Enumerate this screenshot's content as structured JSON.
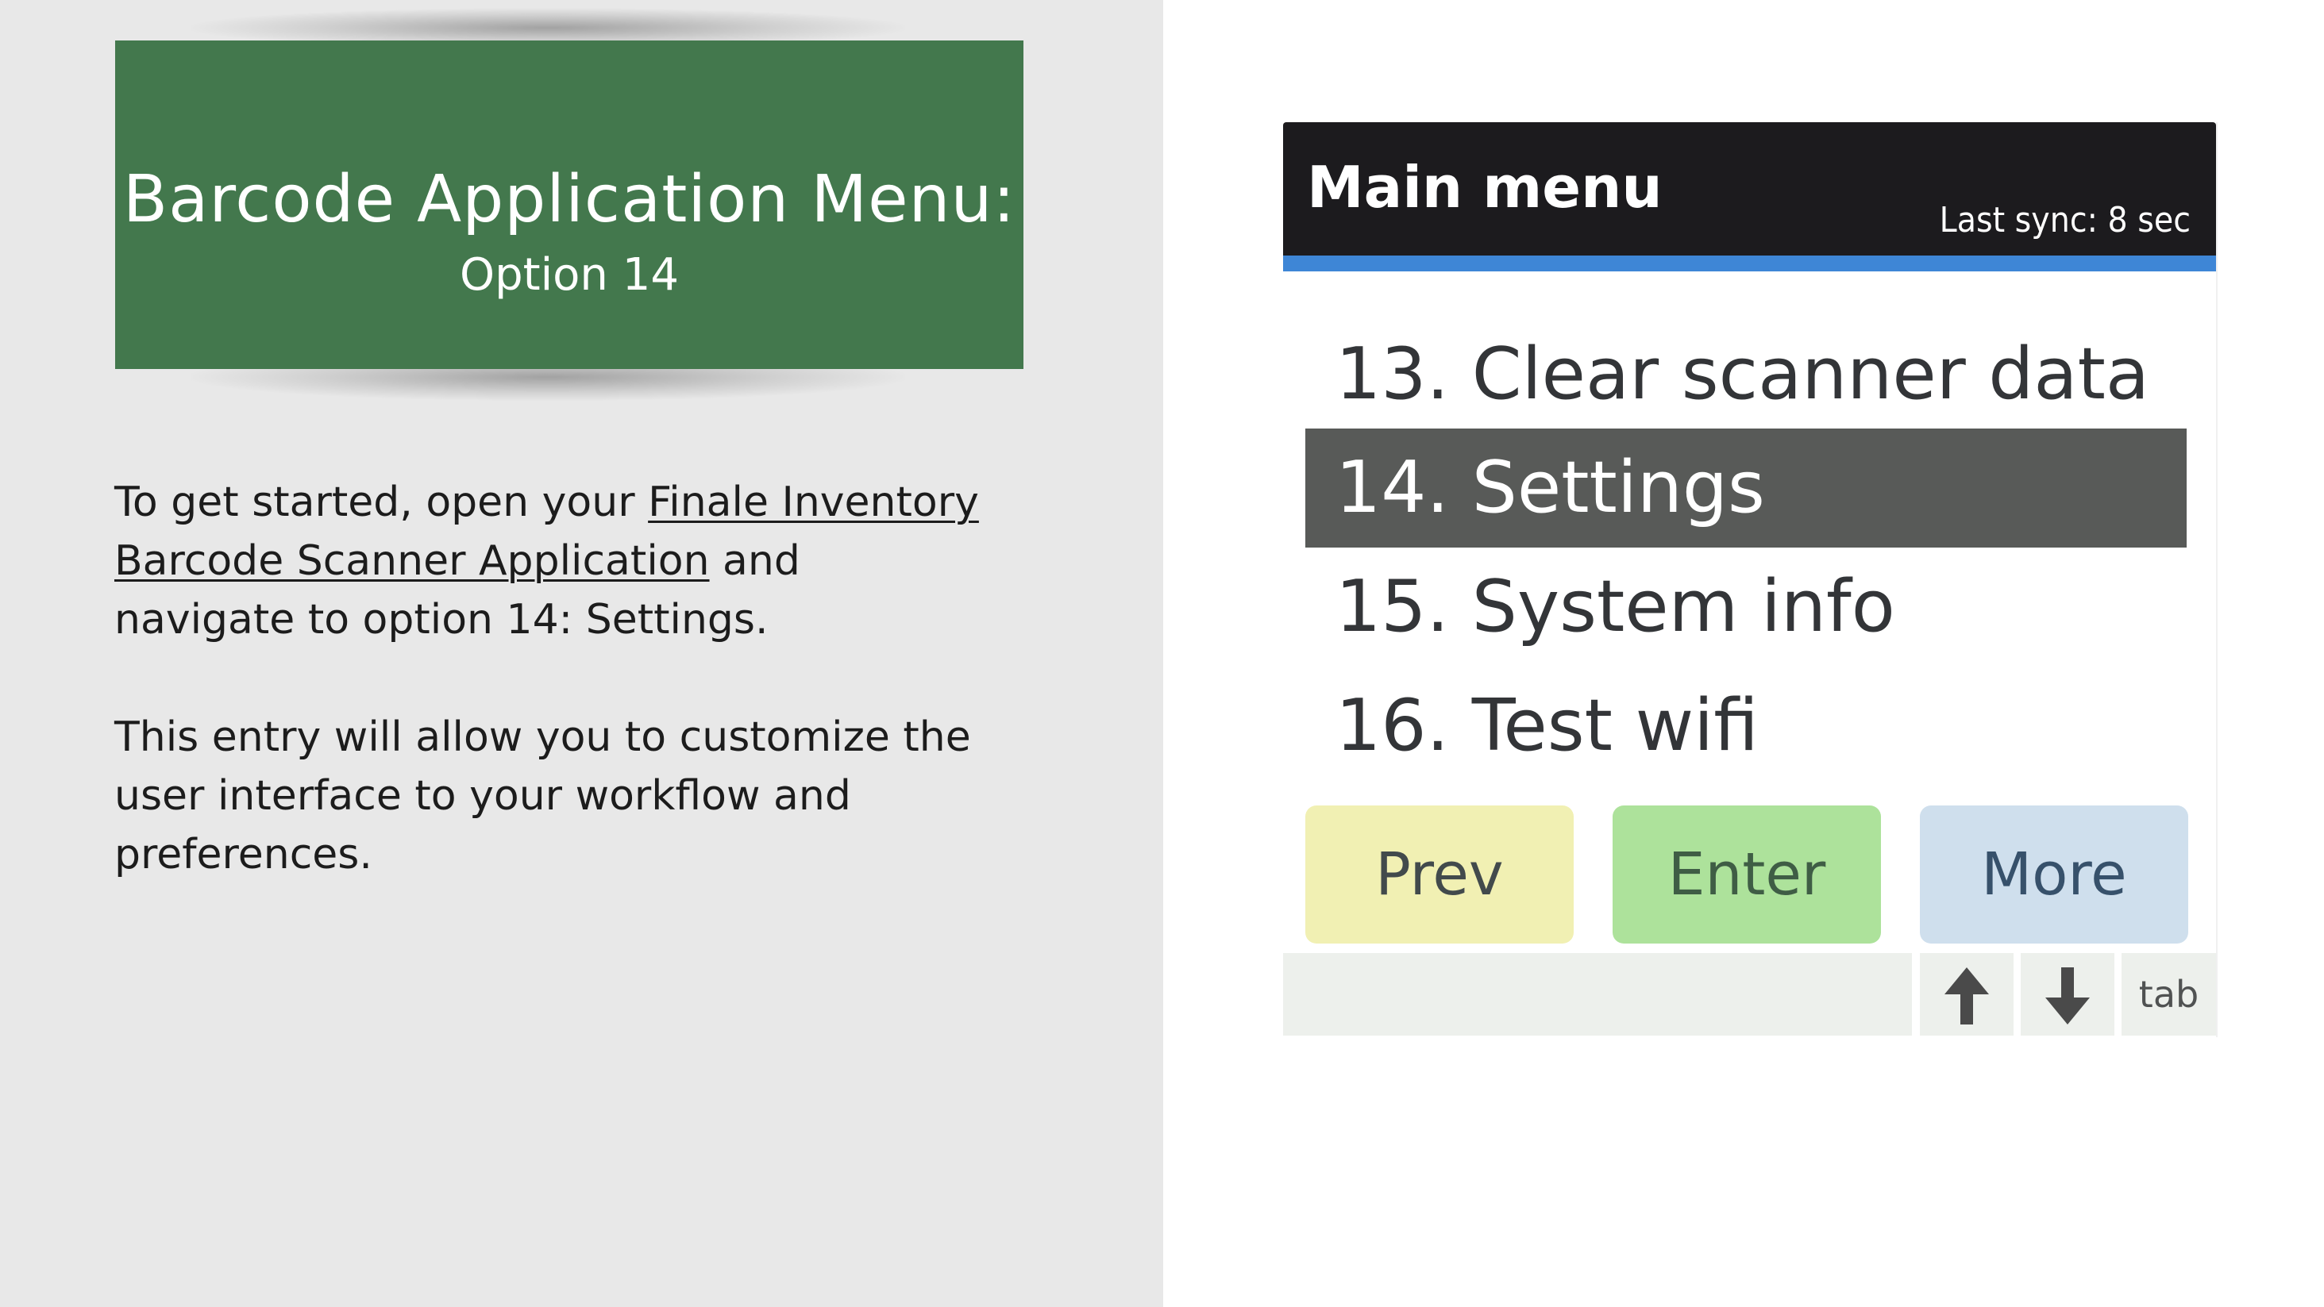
{
  "left": {
    "title": "Barcode Application Menu:",
    "subtitle": "Option 14",
    "paragraph1": {
      "before": "To get started, open your ",
      "link_line1": "Finale Inventory",
      "link_line2": "Barcode Scanner Application",
      "after_line2": " and",
      "line3": "navigate to option 14: Settings."
    },
    "paragraph2": {
      "line1": "This entry will allow you to customize the",
      "line2": "user interface to your workflow and",
      "line3": "preferences."
    }
  },
  "device": {
    "header": {
      "title": "Main menu",
      "last_sync": "Last sync: 8 sec"
    },
    "menu_items": [
      {
        "label": "13. Clear scanner data",
        "selected": false
      },
      {
        "label": "14. Settings",
        "selected": true
      },
      {
        "label": "15. System info",
        "selected": false
      },
      {
        "label": "16. Test wifi",
        "selected": false
      }
    ],
    "buttons": {
      "prev": "Prev",
      "enter": "Enter",
      "more": "More"
    },
    "keys": {
      "up_icon": "arrow-up-icon",
      "down_icon": "arrow-down-icon",
      "tab": "tab"
    }
  },
  "colors": {
    "title_card": "#43784d",
    "header": "#1c1b1e",
    "header_accent": "#3e86d6",
    "selected_item": "#585a58",
    "prev_button": "#f1f0b3",
    "enter_button": "#ade29b",
    "more_button": "#cfdfed"
  }
}
